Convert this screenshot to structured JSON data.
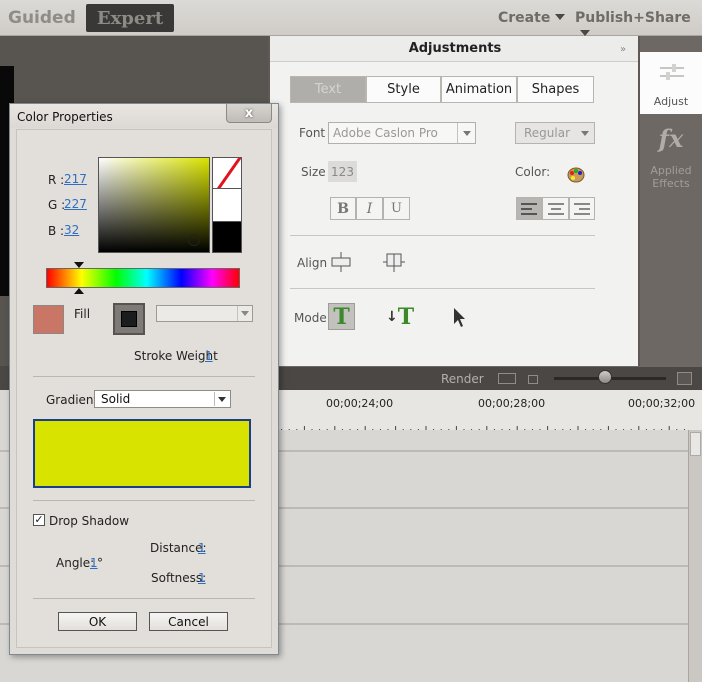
{
  "topbar": {
    "guided": "Guided",
    "expert": "Expert",
    "create": "Create",
    "publish": "Publish+Share"
  },
  "adjustments": {
    "title": "Adjustments",
    "tabs": [
      {
        "label": "Text"
      },
      {
        "label": "Style"
      },
      {
        "label": "Animation"
      },
      {
        "label": "Shapes"
      }
    ],
    "font_label": "Font",
    "font_value": "Adobe Caslon Pro",
    "weight_value": "Regular",
    "size_label": "Size",
    "size_value": "123",
    "color_label": "Color:",
    "bold": "B",
    "italic": "I",
    "underline": "U",
    "align_label": "Align",
    "mode_label": "Mode",
    "mode_t": "T"
  },
  "rightpanel": {
    "adjust": "Adjust",
    "fx": "fx",
    "applied1": "Applied",
    "applied2": "Effects"
  },
  "timeline": {
    "render": "Render",
    "ticks": [
      "00;00;24;00",
      "00;00;28;00",
      "00;00;32;00"
    ]
  },
  "dialog": {
    "title": "Color Properties",
    "close": "x",
    "r_label": "R :",
    "r_value": "217",
    "g_label": "G :",
    "g_value": "227",
    "b_label": "B :",
    "b_value": "32",
    "fill_label": "Fill",
    "stroke_weight_label": "Stroke Weight",
    "stroke_weight_value": "1",
    "gradient_label": "Gradient",
    "gradient_value": "Solid",
    "drop_shadow_label": "Drop Shadow",
    "drop_shadow_checked": true,
    "distance_label": "Distance:",
    "distance_value": "1",
    "angle_label": "Angle:",
    "angle_value": "1",
    "angle_unit": "°",
    "softness_label": "Softness:",
    "softness_value": "1",
    "ok": "OK",
    "cancel": "Cancel"
  },
  "colors": {
    "fill_color": "#c97666",
    "gradient_color": "#d9e300",
    "accent_border": "#1a3f8a"
  }
}
